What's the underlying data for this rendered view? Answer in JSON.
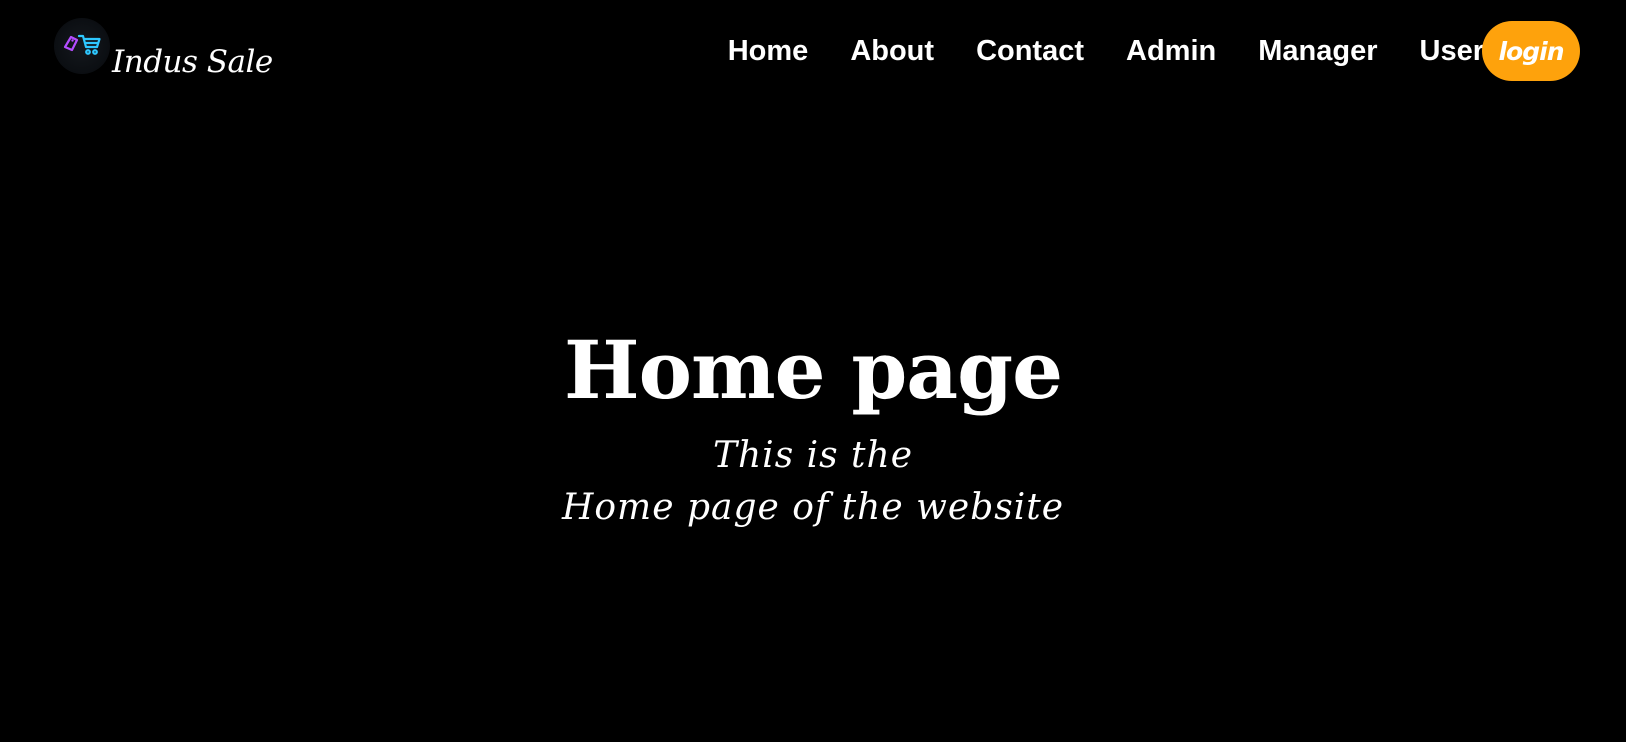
{
  "brand": {
    "name": "Indus Sale",
    "logo_icon": "shopping-cart-tag-icon",
    "logo_colors": {
      "tag": "#b44cff",
      "cart": "#2ec8ff"
    }
  },
  "nav": {
    "links": [
      "Home",
      "About",
      "Contact",
      "Admin",
      "Manager",
      "User"
    ],
    "login_label": "login"
  },
  "hero": {
    "title": "Home page",
    "subtitle_line1": "This is the",
    "subtitle_line2": "Home page of the website"
  },
  "colors": {
    "background": "#000000",
    "text": "#ffffff",
    "accent": "#fea20c"
  }
}
